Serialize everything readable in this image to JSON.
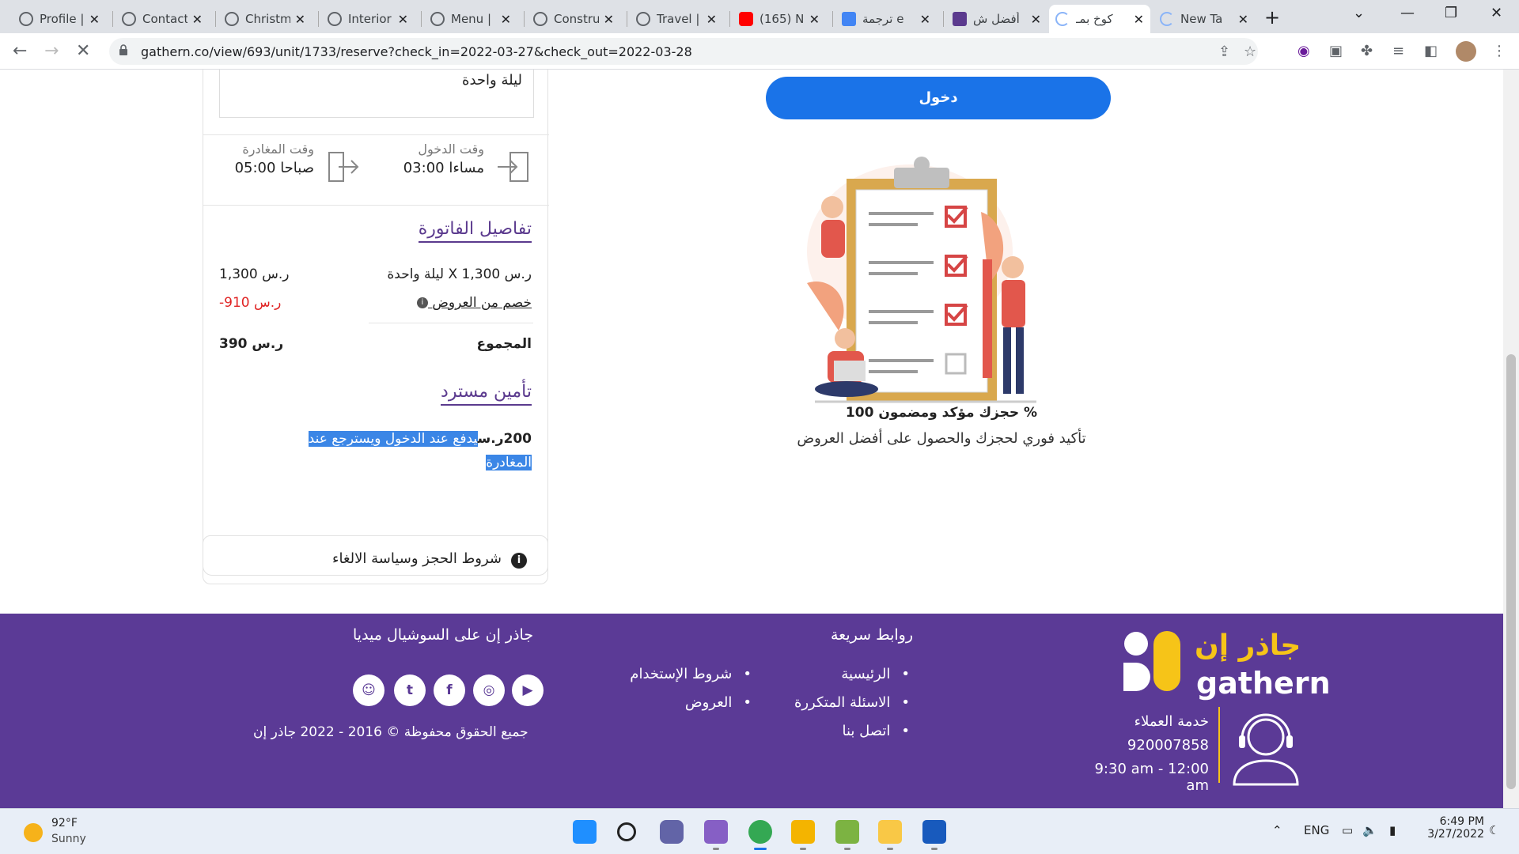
{
  "browser": {
    "tabs": [
      {
        "title": "Profile |",
        "icon": "globe-icon"
      },
      {
        "title": "Contact",
        "icon": "globe-icon"
      },
      {
        "title": "Christm",
        "icon": "globe-icon"
      },
      {
        "title": "Interior",
        "icon": "globe-icon"
      },
      {
        "title": "Menu |",
        "icon": "globe-icon"
      },
      {
        "title": "Constru",
        "icon": "globe-icon"
      },
      {
        "title": "Travel |",
        "icon": "globe-icon"
      },
      {
        "title": "(165) N",
        "icon": "youtube-icon"
      },
      {
        "title": "ترجمة e",
        "icon": "translate-icon"
      },
      {
        "title": "أفضل ش",
        "icon": "gathern-icon"
      },
      {
        "title": "كوخ بمـ",
        "icon": "loading-icon",
        "active": true
      },
      {
        "title": "New Ta",
        "icon": "loading-icon"
      }
    ],
    "url": "gathern.co/view/693/unit/1733/reserve?check_in=2022-03-27&check_out=2022-03-28"
  },
  "booking": {
    "nights_text": "ليلة واحدة",
    "checkin_label": "وقت الدخول",
    "checkin_value": "03:00 مساءا",
    "checkout_label": "وقت المغادرة",
    "checkout_value": "05:00 صباحا",
    "invoice_title": "تفاصيل الفاتورة",
    "line1_label": "ليلة واحدة X 1,300 ر.س",
    "line1_value": "1,300 ر.س",
    "discount_label": "خصم من العروض",
    "discount_value": "-910 ر.س",
    "total_label": "المجموع",
    "total_value": "390 ر.س",
    "deposit_title": "تأمين مسترد",
    "deposit_amount": "200ر.س",
    "deposit_text_1": "يدفع عند الدخول ويسترجع عند",
    "deposit_text_2": "المغادرة",
    "terms_label": "شروط الحجز وسياسة الالغاء"
  },
  "promo": {
    "login_label": "دخول",
    "title": "حجزك مؤكد ومضمون 100 %",
    "subtitle": "تأكيد فوري لحجزك والحصول على أفضل العروض"
  },
  "footer": {
    "quick_links_title": "روابط سريعة",
    "quick_links": [
      "الرئيسية",
      "الاسئلة المتكررة",
      "اتصل بنا"
    ],
    "more_links": [
      "شروط الإستخدام",
      "العروض"
    ],
    "social_title": "جاذر إن على السوشيال ميديا",
    "copyright": "جميع الحقوق محفوظة © 2016 - 2022 جاذر إن",
    "brand_ar": "جاذر إن",
    "brand_en": "gathern",
    "cs_label": "خدمة العملاء",
    "cs_phone": "920007858",
    "cs_hours": "9:30 am - 12:00 am",
    "social_icons": [
      "youtube-icon",
      "instagram-icon",
      "facebook-icon",
      "twitter-icon",
      "snapchat-icon"
    ],
    "colors": {
      "bg": "#5b3a96",
      "accent": "#f6c418"
    }
  },
  "taskbar": {
    "temp": "92°F",
    "weather": "Sunny",
    "lang": "ENG",
    "time": "6:49 PM",
    "date": "3/27/2022"
  }
}
